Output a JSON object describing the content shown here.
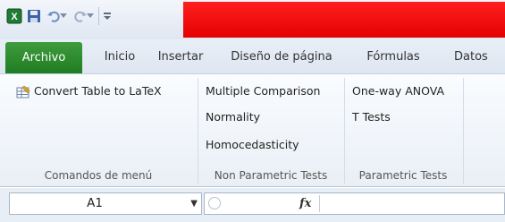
{
  "tabs": {
    "archivo": "Archivo",
    "inicio": "Inicio",
    "insertar": "Insertar",
    "diseno": "Diseño de página",
    "formulas": "Fórmulas",
    "datos": "Datos"
  },
  "ribbon": {
    "menu_commands": {
      "item": "Convert Table to LaTeX",
      "label": "Comandos de menú",
      "icon": "table-latex-icon"
    },
    "non_parametric": {
      "items": [
        "Multiple Comparison",
        "Normality",
        "Homocedasticity"
      ],
      "label": "Non Parametric Tests"
    },
    "parametric": {
      "items": [
        "One-way ANOVA",
        "T Tests"
      ],
      "label": "Parametric Tests"
    }
  },
  "formula_bar": {
    "cell_ref": "A1",
    "fx": "fx"
  },
  "colors": {
    "archivo_tab": "#2a8a2e",
    "title_bar": "#ee0000"
  }
}
